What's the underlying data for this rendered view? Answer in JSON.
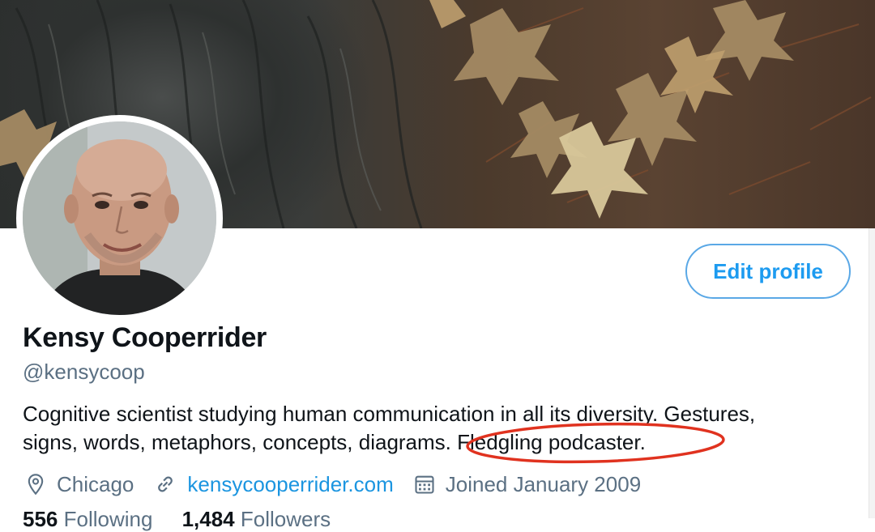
{
  "profile": {
    "name": "Kensy Cooperrider",
    "handle": "@kensycoop",
    "bio_lines": [
      "Cognitive scientist studying human communication in all its diversity. Gestures,",
      "signs, words, metaphors, concepts, diagrams. Fledgling podcaster."
    ],
    "location": "Chicago",
    "website": "kensycooperrider.com",
    "joined": "Joined January 2009"
  },
  "buttons": {
    "edit_profile": "Edit profile"
  },
  "counts": {
    "following_count": "556",
    "following_label": "Following",
    "followers_count": "1,484",
    "followers_label": "Followers"
  },
  "icons": {
    "location": "location-pin-icon",
    "website": "link-icon",
    "joined": "calendar-icon"
  },
  "colors": {
    "accent": "#1d9bf0",
    "link": "#1b95e0",
    "secondary_text": "#5b7083",
    "annotation": "#e0321f"
  }
}
